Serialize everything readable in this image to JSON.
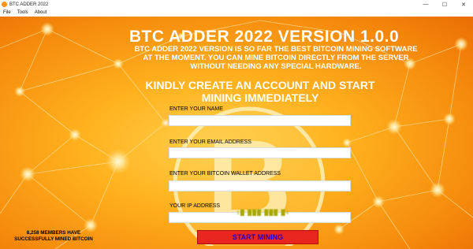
{
  "window": {
    "title": "BTC ADDER 2022",
    "controls": [
      "—",
      "☐",
      "✕"
    ]
  },
  "menu": [
    "File",
    "Tools",
    "About"
  ],
  "header": {
    "title": "BTC ADDER 2022 VERSION 1.0.0",
    "description": "BTC ADDER 2022 VERSION IS SO FAR THE BEST BITCOIN MINING SOFTWARE AT THE MOMENT. YOU CAN MINE BITCOIN DIRECTLY FROM THE SERVER WITHOUT NEEDING ANY SPECIAL HARDWARE.",
    "cta": "KINDLY CREATE AN ACCOUNT AND START MINING IMMEDIATELY"
  },
  "form": {
    "name_label": "ENTER YOUR NAME",
    "name_value": "",
    "email_label": "ENTER YOUR EMAIL ADDRESS",
    "email_value": "",
    "wallet_label": "ENTER YOUR BITCOIN WALLET ADDRESS",
    "wallet_value": "",
    "ip_label": "YOUR IP ADDRESS",
    "ip_value": "1█·███·███·█4",
    "submit_label": "START MINING"
  },
  "stats": {
    "members_text": "8,258 MEMBERS HAVE SUCCESSFULLY MINED BITCOIN"
  },
  "colors": {
    "accent": "#f7931a",
    "button": "#e8261f",
    "button_text": "#1a00d9"
  }
}
